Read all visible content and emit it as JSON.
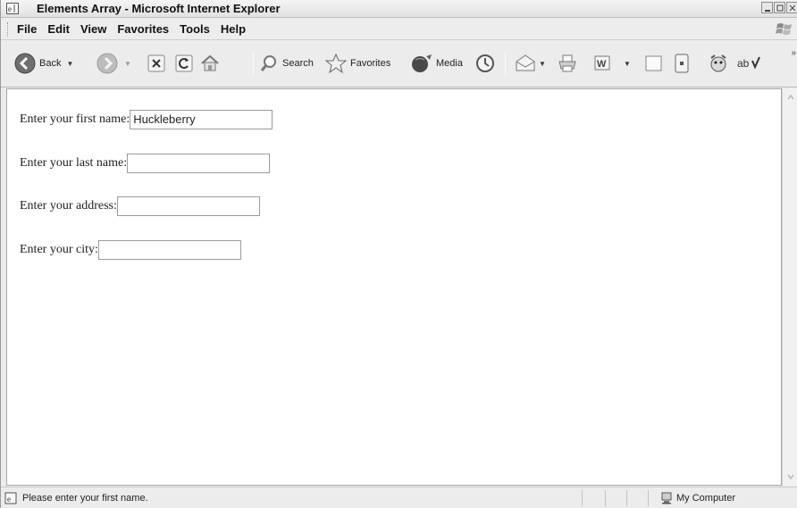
{
  "window": {
    "title": "Elements Array - Microsoft Internet Explorer"
  },
  "menubar": {
    "items": [
      {
        "label": "File"
      },
      {
        "label": "Edit"
      },
      {
        "label": "View"
      },
      {
        "label": "Favorites"
      },
      {
        "label": "Tools"
      },
      {
        "label": "Help"
      }
    ]
  },
  "toolbar": {
    "back_label": "Back",
    "search_label": "Search",
    "favorites_label": "Favorites",
    "media_label": "Media"
  },
  "form": {
    "fields": [
      {
        "label": "Enter your first name:",
        "value": "Huckleberry"
      },
      {
        "label": "Enter your last name:",
        "value": ""
      },
      {
        "label": "Enter your address:",
        "value": ""
      },
      {
        "label": "Enter your city:",
        "value": ""
      }
    ]
  },
  "statusbar": {
    "message": "Please enter your first name.",
    "zone": "My Computer"
  }
}
